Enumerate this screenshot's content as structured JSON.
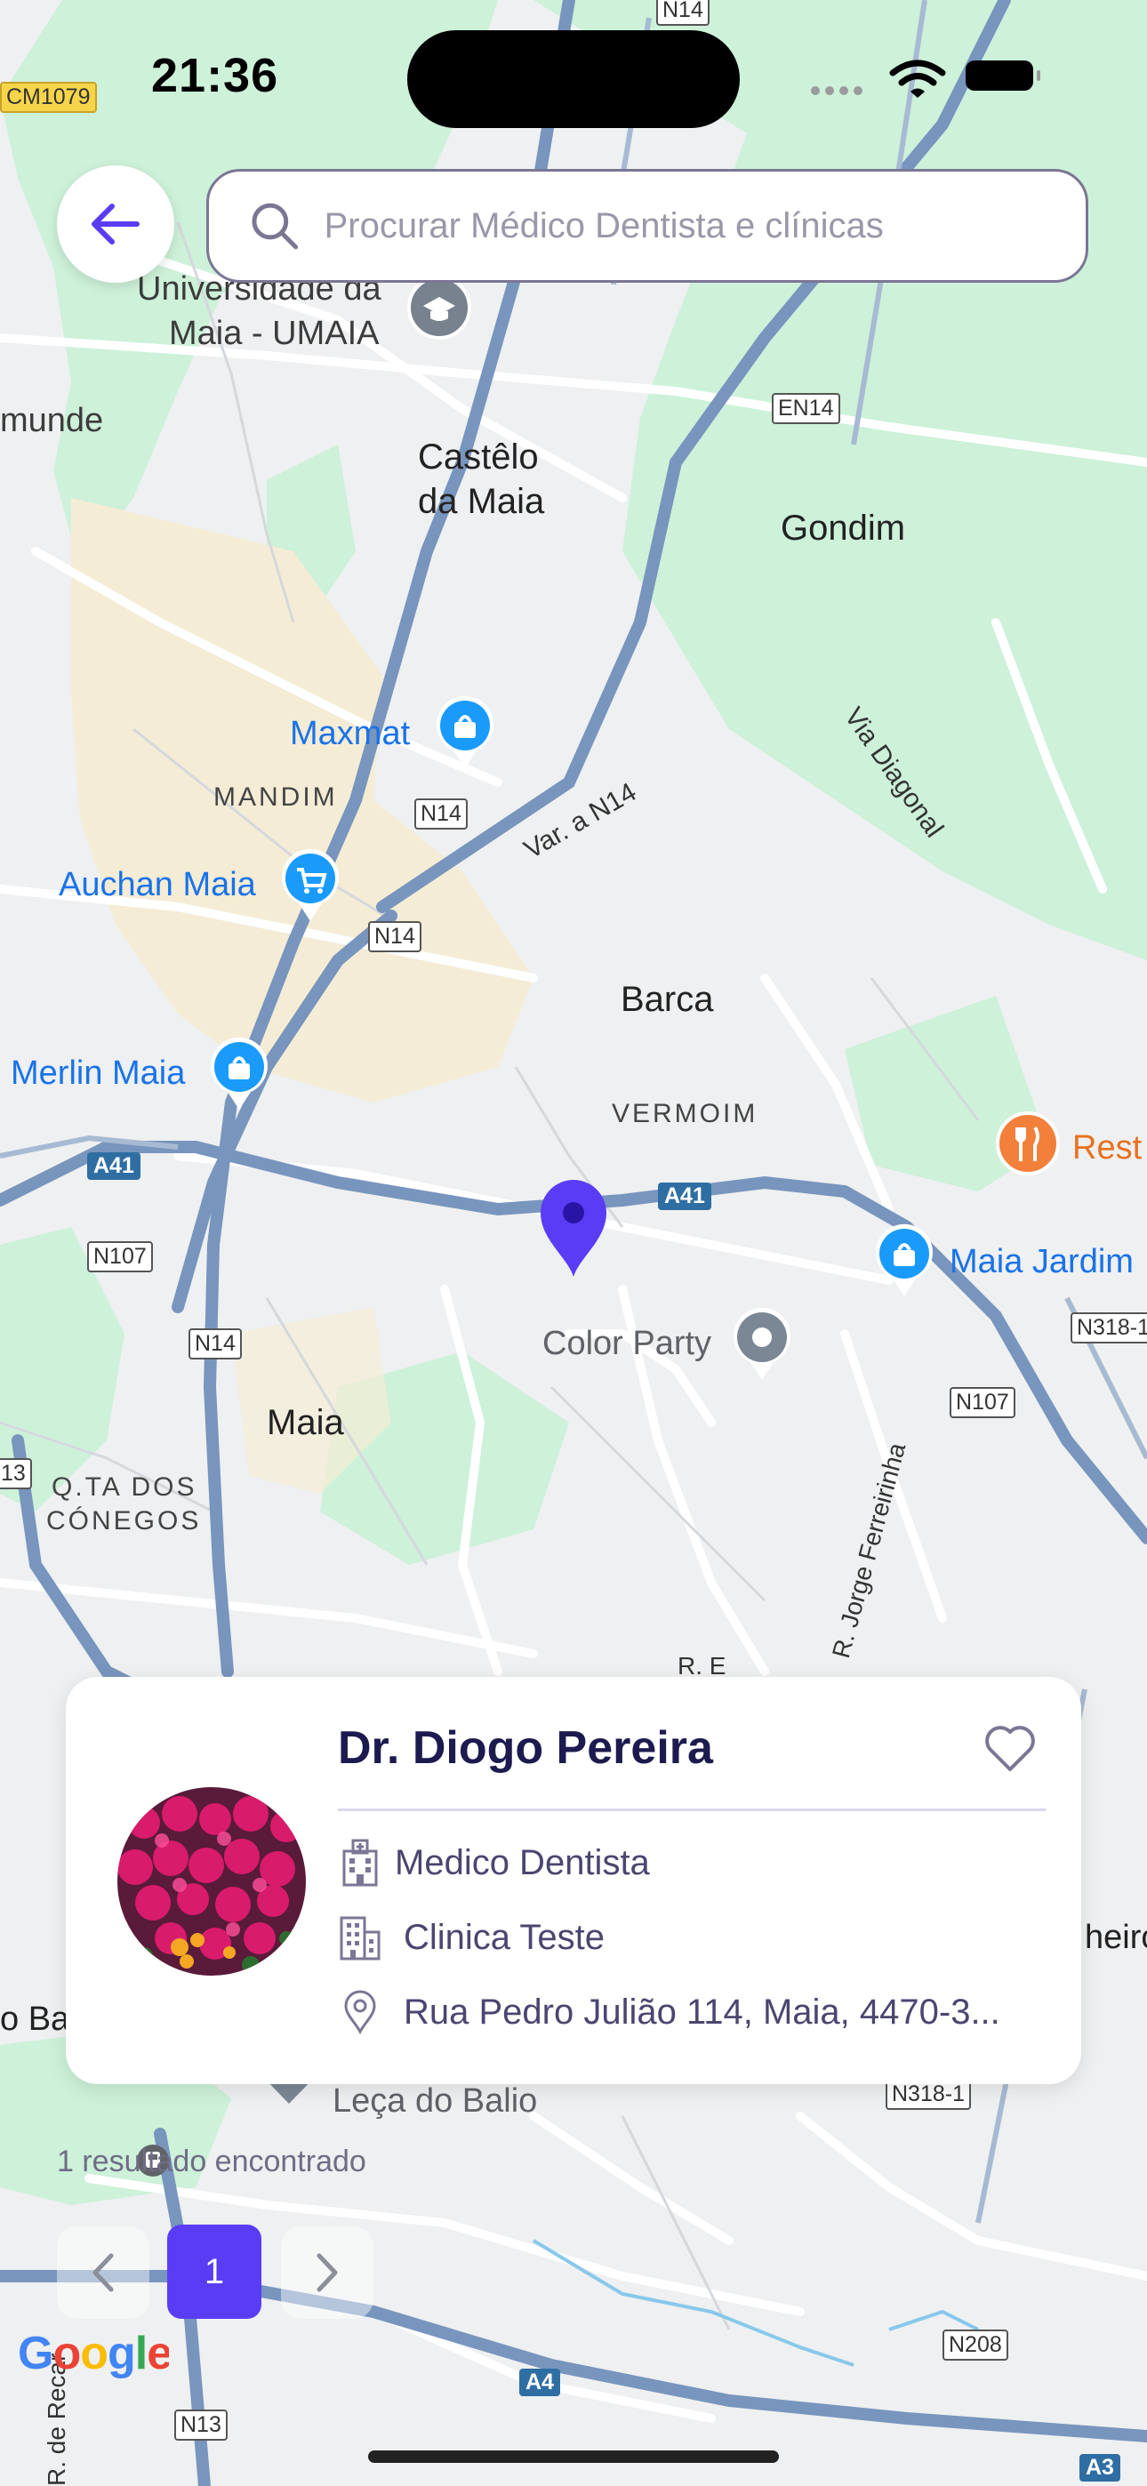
{
  "status_bar": {
    "time": "21:36"
  },
  "search": {
    "placeholder": "Procurar Médico Dentista e clínicas"
  },
  "map": {
    "labels": {
      "cm1079": "CM1079",
      "universidade": "Universidade da",
      "maia_umaia": "Maia - UMAIA",
      "munde": "munde",
      "castelo1": "Castêlo",
      "castelo2": "da Maia",
      "gondim": "Gondim",
      "en14": "EN14",
      "via_diagonal": "Via Diagonal",
      "maxmat": "Maxmat",
      "mandim": "MANDIM",
      "n14_a": "N14",
      "var_a_n14": "Var. a N14",
      "auchan": "Auchan Maia",
      "n14_b": "N14",
      "barca": "Barca",
      "merlin": "Merlin Maia",
      "vermoim": "VERMOIM",
      "rest": "Rest",
      "a41_left": "A41",
      "a41_right": "A41",
      "maia_jardim": "Maia Jardim",
      "n107_left": "N107",
      "color_party": "Color Party",
      "n318_top": "N318-1",
      "n14_c": "N14",
      "n107_right": "N107",
      "maia": "Maia",
      "n13_side": "13",
      "qta1": "Q.TA DOS",
      "qta2": "CÓNEGOS",
      "jorge": "R. Jorge Ferreirinha",
      "r_e": "R. E",
      "leca": "Leça do Balio",
      "o_ba": "o Ba",
      "heiro": "heiró",
      "n318_bottom": "N318-1",
      "n208": "N208",
      "a4": "A4",
      "n13": "N13",
      "a3": "A3",
      "r_de_reca": "R. de Recar",
      "top_n14": "N14",
      "google": "Google"
    },
    "colors": {
      "land": "#eef0f1",
      "park": "#cdf1d9",
      "road": "#7895bd",
      "urban": "#f5ecd6",
      "pin": "#5b3cf5"
    }
  },
  "doctor_card": {
    "name": "Dr. Diogo Pereira",
    "specialty": "Medico Dentista",
    "clinic": "Clinica Teste",
    "address": "Rua Pedro Julião 114, Maia, 4470-3..."
  },
  "results": {
    "text": "1 resultado encontrado"
  },
  "pagination": {
    "current_page": "1"
  },
  "icons": [
    "arrow-left-icon",
    "search-icon",
    "heart-icon",
    "hospital-icon",
    "building-icon",
    "location-pin-icon",
    "chevron-left-icon",
    "chevron-right-icon",
    "wifi-icon",
    "battery-icon"
  ]
}
